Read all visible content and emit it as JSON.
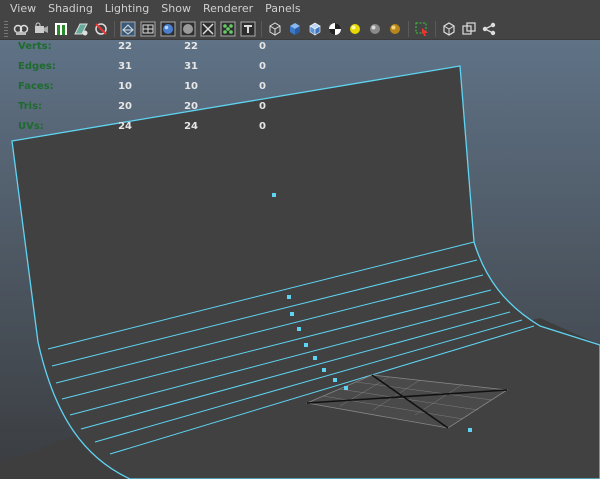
{
  "menu": {
    "items": [
      "View",
      "Shading",
      "Lighting",
      "Show",
      "Renderer",
      "Panels"
    ]
  },
  "toolbar": {
    "groups": [
      [
        "camera-select-icon",
        "camera-attributes-icon",
        "bookmark-icon",
        "image-plane-icon",
        "grid-toggle-icon"
      ],
      [
        "wireframe-icon",
        "smooth-shade-icon",
        "sphere-shade-icon",
        "flat-shade-icon",
        "xray-icon",
        "textured-icon",
        "texture-text-icon"
      ],
      [
        "wire-cube-icon",
        "shaded-cube-icon",
        "shaded-wire-cube-icon",
        "checker-icon",
        "default-light-icon",
        "grey-sphere-icon",
        "gold-sphere-icon"
      ],
      [
        "isolate-select-icon"
      ],
      [
        "box-icon",
        "duplicate-box-icon",
        "node-graph-icon"
      ]
    ]
  },
  "hud": {
    "rows": [
      {
        "label": "Verts:",
        "v1": "22",
        "v2": "22",
        "v3": "0"
      },
      {
        "label": "Edges:",
        "v1": "31",
        "v2": "31",
        "v3": "0"
      },
      {
        "label": "Faces:",
        "v1": "10",
        "v2": "10",
        "v3": "0"
      },
      {
        "label": "Tris:",
        "v1": "20",
        "v2": "20",
        "v3": "0"
      },
      {
        "label": "UVs:",
        "v1": "24",
        "v2": "24",
        "v3": "0"
      }
    ]
  },
  "colors": {
    "wire": "#5fd4f2",
    "hud_label": "#1e6b2e",
    "surface": "#404040",
    "menu_bg": "#444444"
  }
}
